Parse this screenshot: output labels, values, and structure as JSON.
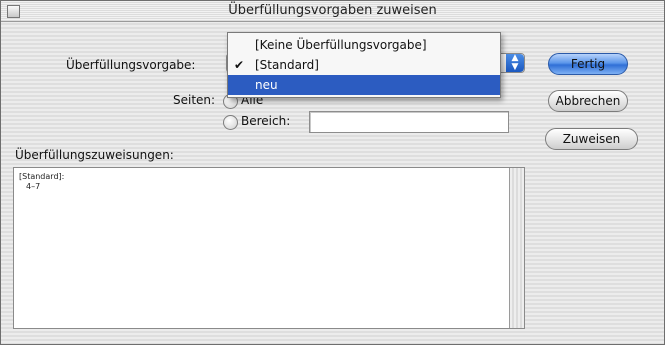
{
  "window": {
    "title": "Überfüllungsvorgaben zuweisen"
  },
  "form": {
    "preset_label": "Überfüllungsvorgabe:",
    "pages_label": "Seiten:",
    "radio_all_label": "Alle",
    "radio_range_label": "Bereich:",
    "range_value": ""
  },
  "dropdown": {
    "options": [
      {
        "label": "[Keine Überfüllungsvorgabe]",
        "checked": false,
        "highlighted": false
      },
      {
        "label": "[Standard]",
        "checked": true,
        "highlighted": false
      },
      {
        "label": "neu",
        "checked": false,
        "highlighted": true
      }
    ],
    "check_glyph": "✔"
  },
  "buttons": {
    "done": "Fertig",
    "cancel": "Abbrechen",
    "assign": "Zuweisen"
  },
  "assignments": {
    "heading": "Überfüllungszuweisungen:",
    "entries": [
      {
        "preset": "[Standard]:",
        "pages": "4–7"
      }
    ]
  },
  "colors": {
    "highlight": "#2c5cc1",
    "default_button": "#2f6fd6"
  }
}
